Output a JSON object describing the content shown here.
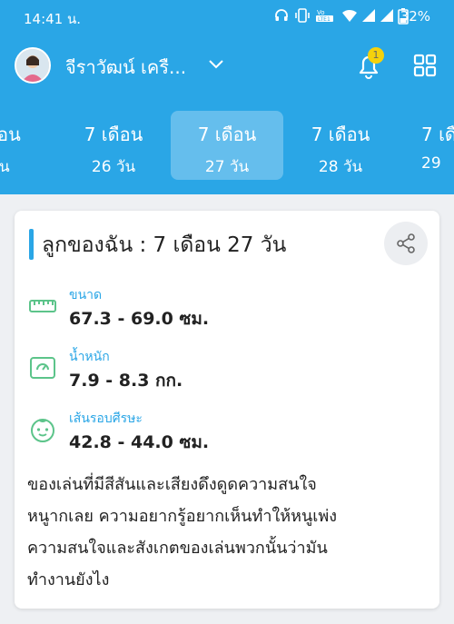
{
  "status_bar": {
    "time": "14:41 น.",
    "battery": "32%",
    "icons": [
      "headphones-icon",
      "vibrate-icon",
      "volte-icon",
      "wifi-icon",
      "signal-icon",
      "signal-icon",
      "battery-icon"
    ]
  },
  "app_bar": {
    "baby_name": "จีราวัฒน์ เครื...",
    "notification_count": "1"
  },
  "tabs": [
    {
      "line1": "เดือน",
      "line2": "วัน"
    },
    {
      "line1": "7 เดือน",
      "line2": "26 วัน"
    },
    {
      "line1": "7 เดือน",
      "line2": "27 วัน",
      "active": true
    },
    {
      "line1": "7 เดือน",
      "line2": "28 วัน"
    },
    {
      "line1": "7 เดื",
      "line2": "29"
    }
  ],
  "card": {
    "title": "ลูกของฉัน : 7  เดือน 27  วัน",
    "metrics": [
      {
        "label": "ขนาด",
        "value": "67.3 - 69.0 ซม.",
        "icon": "ruler-icon"
      },
      {
        "label": "น้ำหนัก",
        "value": "7.9 - 8.3 กก.",
        "icon": "scale-icon"
      },
      {
        "label": "เส้นรอบศีรษะ",
        "value": "42.8 - 44.0 ซม.",
        "icon": "baby-face-icon"
      }
    ],
    "description_lines": [
      "ของเล่นที่มีสีสันและเสียงดึงดูดความสนใจ",
      "หนูากเลย ความอยากรู้อยากเห็นทำให้หนูเพ่ง",
      "ความสนใจและสังเกตของเล่นพวกนั้นว่ามัน",
      "ทำงานยังไง"
    ]
  },
  "colors": {
    "primary": "#2aa6e6",
    "icon_green": "#5cc48a",
    "badge": "#f5d20c"
  }
}
